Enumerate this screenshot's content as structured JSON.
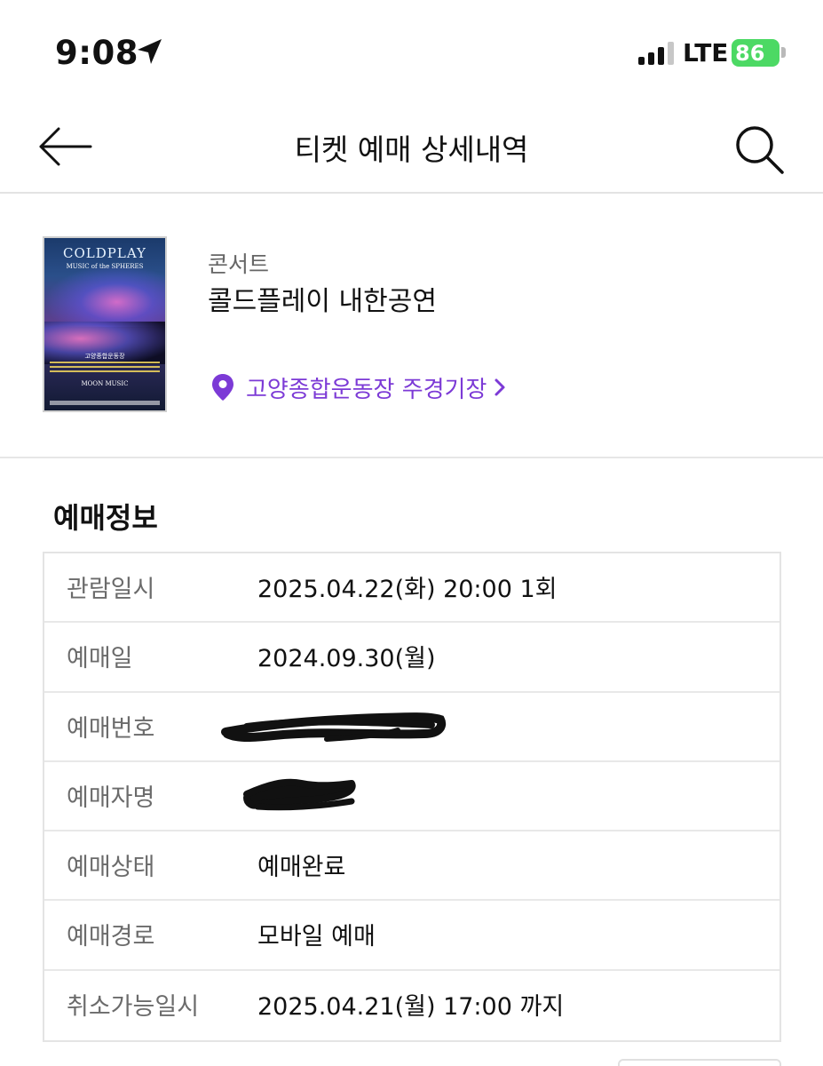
{
  "status_bar": {
    "time": "9:08",
    "network": "LTE",
    "battery": "86",
    "icons": [
      "location-arrow-icon",
      "signal-bars-icon",
      "battery-charging-icon"
    ]
  },
  "header": {
    "title": "티켓 예매 상세내역",
    "back_icon": "arrow-left-icon",
    "search_icon": "search-icon"
  },
  "event": {
    "category": "콘서트",
    "title": "콜드플레이 내한공연",
    "venue": "고양종합운동장 주경기장",
    "venue_icon": "map-pin-icon",
    "poster": {
      "title": "COLDPLAY",
      "subtitle": "MUSIC of the SPHERES",
      "venue_text": "고양종합운동장",
      "footer": "MOON MUSIC"
    }
  },
  "booking": {
    "section_title": "예매정보",
    "rows": [
      {
        "label": "관람일시",
        "value": "2025.04.22(화) 20:00 1회"
      },
      {
        "label": "예매일",
        "value": "2024.09.30(월)"
      },
      {
        "label": "예매번호",
        "value": ""
      },
      {
        "label": "예매자명",
        "value": ""
      },
      {
        "label": "예매상태",
        "value": "예매완료"
      },
      {
        "label": "예매경로",
        "value": "모바일 예매"
      },
      {
        "label": "취소가능일시",
        "value": "2025.04.21(월) 17:00 까지"
      }
    ]
  },
  "colors": {
    "accent": "#7c3ad6",
    "battery": "#4cd964",
    "divider": "#e4e4e4",
    "label_text": "#6b6b6b"
  }
}
